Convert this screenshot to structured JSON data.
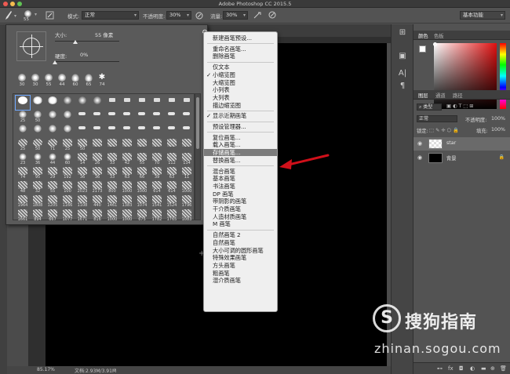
{
  "window": {
    "title": "Adobe Photoshop CC 2015.5"
  },
  "options_bar": {
    "brush_size": "55",
    "mode_label": "模式:",
    "mode_value": "正常",
    "opacity_label": "不透明度:",
    "opacity_value": "30%",
    "flow_label": "流量:",
    "flow_value": "30%",
    "workspace_value": "基本功能"
  },
  "brush_picker": {
    "size_label": "大小:",
    "size_value": "55 像素",
    "hardness_label": "硬度:",
    "hardness_value": "0%",
    "top_presets": [
      "30",
      "30",
      "55",
      "44",
      "60",
      "65",
      "74"
    ],
    "grid_numbers": [
      "",
      "",
      "",
      "",
      "",
      "",
      "",
      "",
      "",
      "",
      "",
      "",
      "25",
      "50",
      "",
      "",
      "",
      "",
      "",
      "",
      "",
      "",
      "",
      "",
      "",
      "",
      "",
      "",
      "",
      "",
      "",
      "",
      "",
      "",
      "",
      "",
      "25",
      "50",
      "71",
      "25",
      "50",
      "",
      "",
      "",
      "",
      "",
      "",
      "",
      "23",
      "36",
      "44",
      "60",
      "14",
      "26",
      "33",
      "42",
      "55",
      "70",
      "112",
      "134",
      "74",
      "95",
      "29",
      "192",
      "36",
      "36",
      "33",
      "63",
      "66",
      "39",
      "63",
      "11",
      "48",
      "32",
      "55",
      "100",
      "2023",
      "2173",
      "800",
      "1000",
      "1000",
      "614",
      "614",
      "1000",
      "1964",
      "1808",
      "1205",
      "1166",
      "1108",
      "440",
      "1461",
      "1383",
      "1074",
      "1541",
      "1524",
      "1796",
      "1661",
      "894",
      "667",
      "1077",
      "1671",
      "816",
      "1000",
      "1000",
      "675",
      "1782",
      "1765",
      "1083"
    ]
  },
  "context_menu": {
    "items": [
      "新建画笔预设...",
      "重命名画笔...",
      "删除画笔",
      "仅文本",
      "小缩览图",
      "大缩览图",
      "小列表",
      "大列表",
      "描边缩览图",
      "显示近期画笔",
      "预设管理器...",
      "复位画笔...",
      "载入画笔...",
      "存储画笔...",
      "替换画笔...",
      "混合画笔",
      "基本画笔",
      "书法画笔",
      "DP 画笔",
      "带阴影的画笔",
      "干介质画笔",
      "人造材质画笔",
      "M 画笔",
      "自然画笔 2",
      "自然画笔",
      "大小可调的圆形画笔",
      "特殊效果画笔",
      "方头画笔",
      "粗画笔",
      "湿介质画笔"
    ]
  },
  "status_bar": {
    "zoom": "85.17%",
    "doc_info": "文档:2.93M/3.91M"
  },
  "right_panel": {
    "color_tabs": [
      "颜色",
      "色板"
    ],
    "layer_tabs": [
      "图层",
      "通道",
      "路径"
    ],
    "kind_filter": "类型",
    "blend_mode": "正常",
    "opacity_label": "不透明度:",
    "opacity_value": "100%",
    "lock_label": "锁定:",
    "fill_label": "填充:",
    "fill_value": "100%",
    "layers": [
      {
        "name": "star"
      },
      {
        "name": "背景"
      }
    ]
  },
  "watermark": {
    "title": "搜狗指南",
    "url": "zhinan.sogou.com",
    "logo_letter": "S"
  },
  "colors": {
    "menu_highlight": "#7b7b7b",
    "arrow": "#d0101a",
    "canvas": "#000000"
  }
}
